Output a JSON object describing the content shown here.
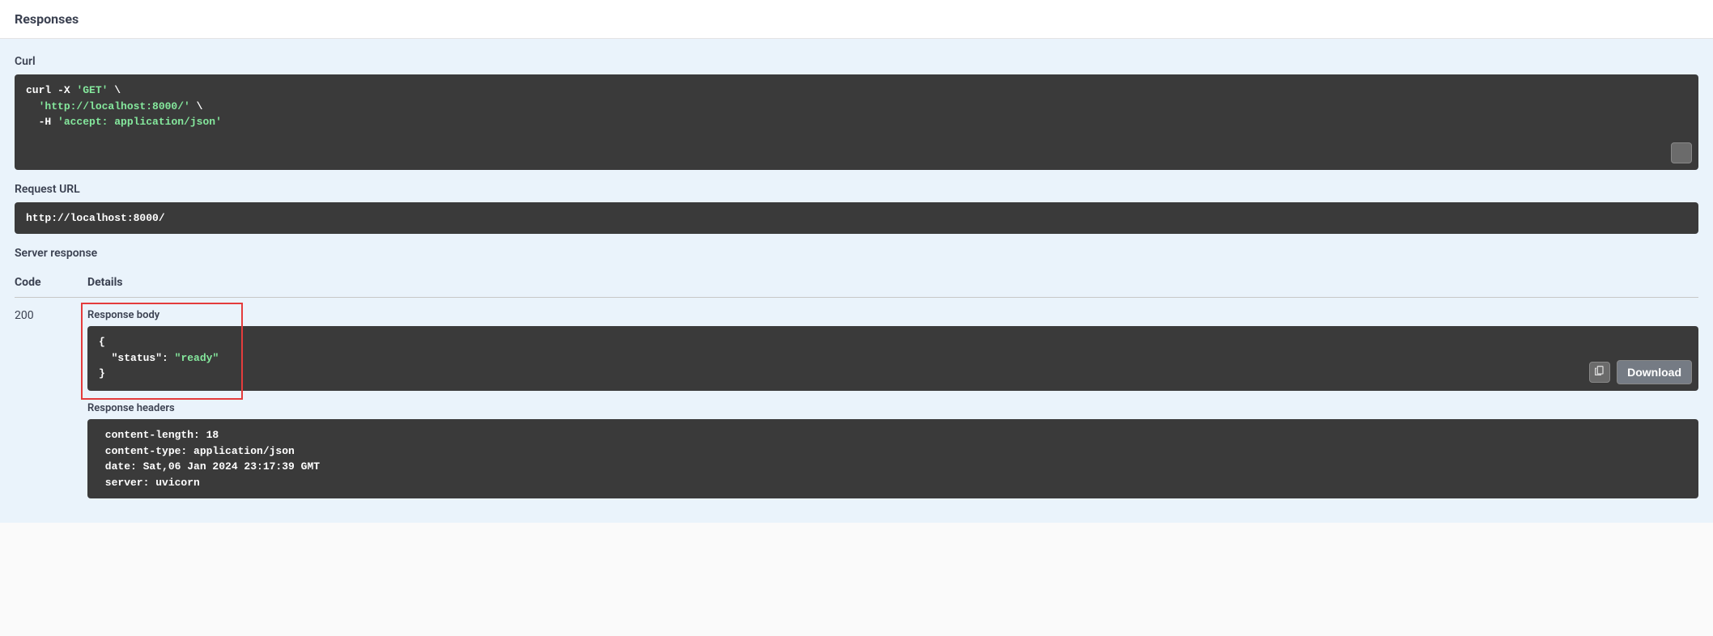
{
  "title": "Responses",
  "curl": {
    "label": "Curl",
    "parts": {
      "cmd": "curl",
      "flag_x": "-X",
      "method": "'GET'",
      "url": "'http://localhost:8000/'",
      "flag_h": "-H",
      "hdr": "'accept: application/json'",
      "bs": "\\"
    }
  },
  "request_url": {
    "label": "Request URL",
    "value": "http://localhost:8000/"
  },
  "server_response_label": "Server response",
  "table": {
    "col_code": "Code",
    "col_details": "Details"
  },
  "response": {
    "code": "200",
    "body_label": "Response body",
    "body_json": {
      "open": "{",
      "key": "\"status\"",
      "colon": ":",
      "value": "\"ready\"",
      "close": "}"
    },
    "download_label": "Download",
    "headers_label": "Response headers",
    "headers": " content-length: 18 \n content-type: application/json \n date: Sat,06 Jan 2024 23:17:39 GMT \n server: uvicorn "
  }
}
